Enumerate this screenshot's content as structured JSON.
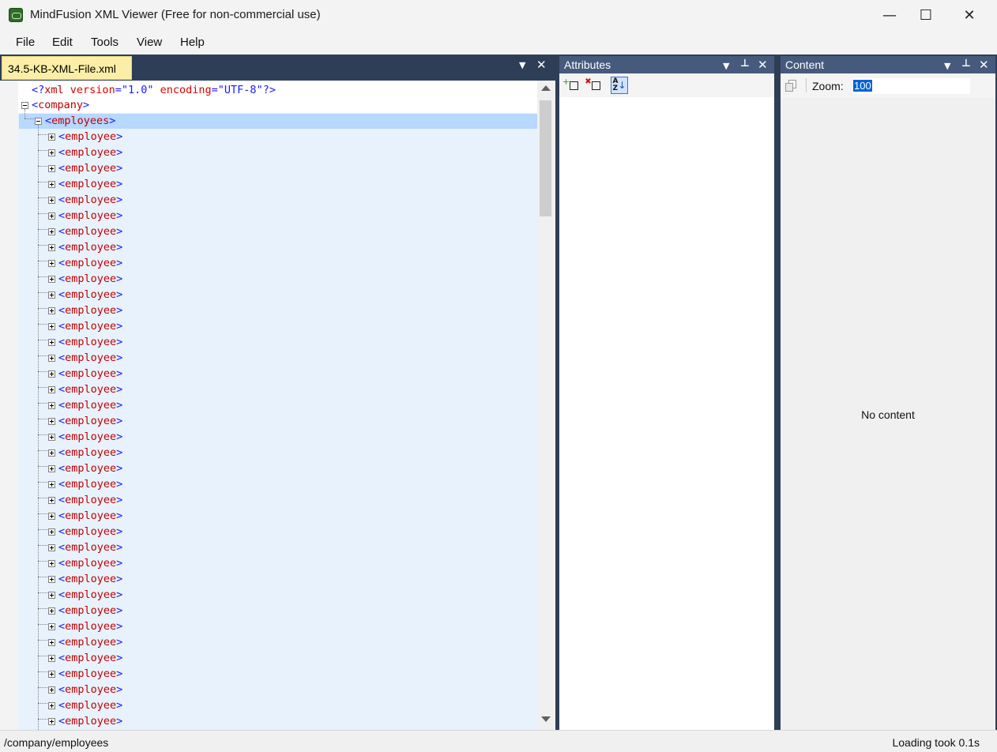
{
  "window": {
    "title": "MindFusion XML Viewer (Free for non-commercial use)",
    "minimize_glyph": "—",
    "maximize_glyph": "☐",
    "close_glyph": "✕"
  },
  "menu": [
    "File",
    "Edit",
    "Tools",
    "View",
    "Help"
  ],
  "document_tab": {
    "label": "34.5-KB-XML-File.xml"
  },
  "editor": {
    "declaration": {
      "open": "<?",
      "name": "xml",
      "attr1": "version",
      "val1": "\"1.0\"",
      "attr2": "encoding",
      "val2": "\"UTF-8\"",
      "close": "?>"
    },
    "root_node": "company",
    "selected_node": "employees",
    "child_node": "employee",
    "child_count": 38
  },
  "attributes_panel": {
    "title": "Attributes",
    "toolbar": [
      "add-attribute",
      "delete-attribute",
      "sort-alphabetically"
    ]
  },
  "content_panel": {
    "title": "Content",
    "zoom_label": "Zoom:",
    "zoom_value": "100",
    "empty_text": "No content"
  },
  "status": {
    "path": "/company/employees",
    "timing": "Loading took 0.1s"
  },
  "colors": {
    "panel_header": "#465a7d",
    "shell_bg": "#2e3e56",
    "tab_active": "#fbeea6",
    "tag": "#c00000",
    "bracket": "#1a1aff",
    "selection": "#b7d8ff"
  }
}
